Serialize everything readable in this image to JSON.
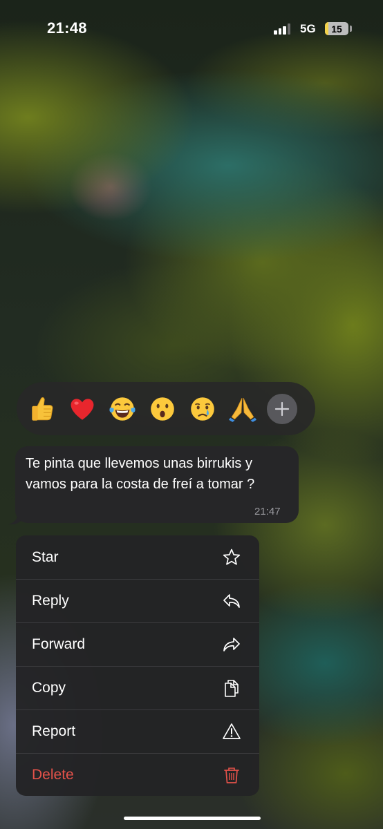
{
  "status_bar": {
    "time": "21:48",
    "network": "5G",
    "battery": "15",
    "battery_level_percent": 15,
    "signal_bars_filled": 3,
    "signal_bars_total": 4
  },
  "reactions": [
    {
      "name": "thumbs-up",
      "emoji": "👍"
    },
    {
      "name": "red-heart",
      "emoji": "❤️"
    },
    {
      "name": "tears-of-joy",
      "emoji": "😂"
    },
    {
      "name": "surprised",
      "emoji": "😮"
    },
    {
      "name": "crying",
      "emoji": "😢"
    },
    {
      "name": "folded-hands",
      "emoji": "🙏"
    }
  ],
  "message": {
    "text": "Te pinta que llevemos unas birrukis y vamos para la costa de freí a tomar ?",
    "time": "21:47"
  },
  "menu": {
    "items": [
      {
        "label": "Star",
        "icon": "star-icon"
      },
      {
        "label": "Reply",
        "icon": "reply-icon"
      },
      {
        "label": "Forward",
        "icon": "forward-icon"
      },
      {
        "label": "Copy",
        "icon": "copy-icon"
      },
      {
        "label": "Report",
        "icon": "warning-icon"
      },
      {
        "label": "Delete",
        "icon": "trash-icon",
        "destructive": true
      }
    ]
  },
  "colors": {
    "destructive": "#e5524a",
    "bubble": "#262628",
    "menu": "#232325",
    "battery_fill": "#f3d24a"
  }
}
